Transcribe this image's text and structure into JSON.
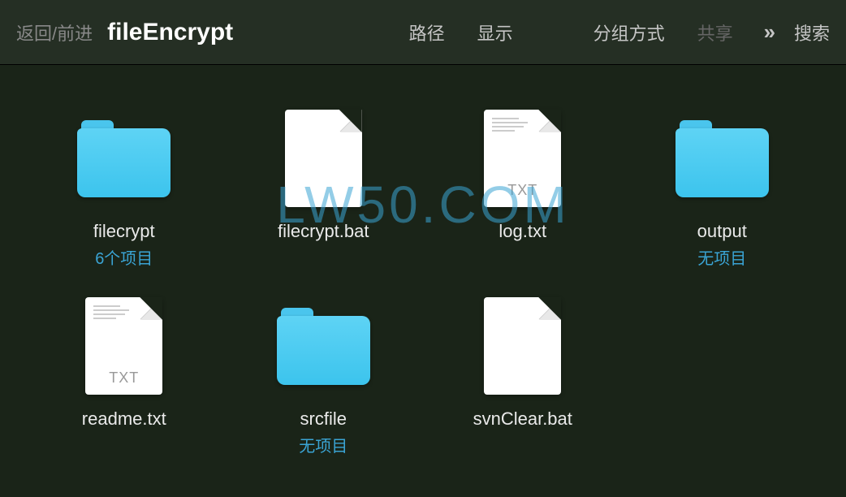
{
  "toolbar": {
    "back_forward": "返回/前进",
    "title": "fileEncrypt",
    "path": "路径",
    "view": "显示",
    "group": "分组方式",
    "share": "共享",
    "search": "搜索"
  },
  "items": [
    {
      "name": "filecrypt",
      "sub": "6个项目",
      "type": "folder"
    },
    {
      "name": "filecrypt.bat",
      "sub": "",
      "type": "file",
      "ext": ""
    },
    {
      "name": "log.txt",
      "sub": "",
      "type": "txt",
      "ext": "TXT"
    },
    {
      "name": "output",
      "sub": "无项目",
      "type": "folder"
    },
    {
      "name": "readme.txt",
      "sub": "",
      "type": "txt",
      "ext": "TXT"
    },
    {
      "name": "srcfile",
      "sub": "无项目",
      "type": "folder"
    },
    {
      "name": "svnClear.bat",
      "sub": "",
      "type": "file",
      "ext": ""
    }
  ],
  "watermark": "LW50.COM"
}
